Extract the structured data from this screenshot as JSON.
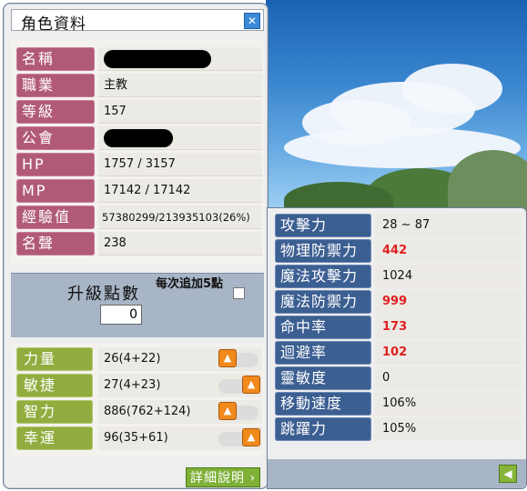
{
  "window": {
    "title": "角色資料"
  },
  "info": [
    {
      "label": "名稱",
      "value": ""
    },
    {
      "label": "職業",
      "value": "主教"
    },
    {
      "label": "等級",
      "value": "157"
    },
    {
      "label": "公會",
      "value": ""
    },
    {
      "label": "HP",
      "value": "1757 / 3157"
    },
    {
      "label": "MP",
      "value": "17142 / 17142"
    },
    {
      "label": "經驗值",
      "value": "57380299/213935103(26%)"
    },
    {
      "label": "名聲",
      "value": "238"
    }
  ],
  "points": {
    "title": "升級點數",
    "value": "0",
    "auto_add_label": "每次追加5點"
  },
  "stats": [
    {
      "label": "力量",
      "value": "26(4+22)"
    },
    {
      "label": "敏捷",
      "value": "27(4+23)"
    },
    {
      "label": "智力",
      "value": "886(762+124)"
    },
    {
      "label": "幸運",
      "value": "96(35+61)"
    }
  ],
  "detail_button": "詳細說明",
  "combat": [
    {
      "label": "攻擊力",
      "value": "28 ~ 87"
    },
    {
      "label": "物理防禦力",
      "value": "442"
    },
    {
      "label": "魔法攻擊力",
      "value": "1024"
    },
    {
      "label": "魔法防禦力",
      "value": "999"
    },
    {
      "label": "命中率",
      "value": "173"
    },
    {
      "label": "迴避率",
      "value": "102"
    },
    {
      "label": "靈敏度",
      "value": "0"
    },
    {
      "label": "移動速度",
      "value": "106%"
    },
    {
      "label": "跳躍力",
      "value": "105%"
    }
  ],
  "colors": {
    "info_label": "#b15a78",
    "stat_label": "#91ad3f",
    "combat_label": "#3c5f92",
    "highlight": "#e02020"
  },
  "icons": {
    "title_button": "close-icon",
    "stat_up": "arrow-up-icon",
    "back": "arrow-left-icon"
  }
}
